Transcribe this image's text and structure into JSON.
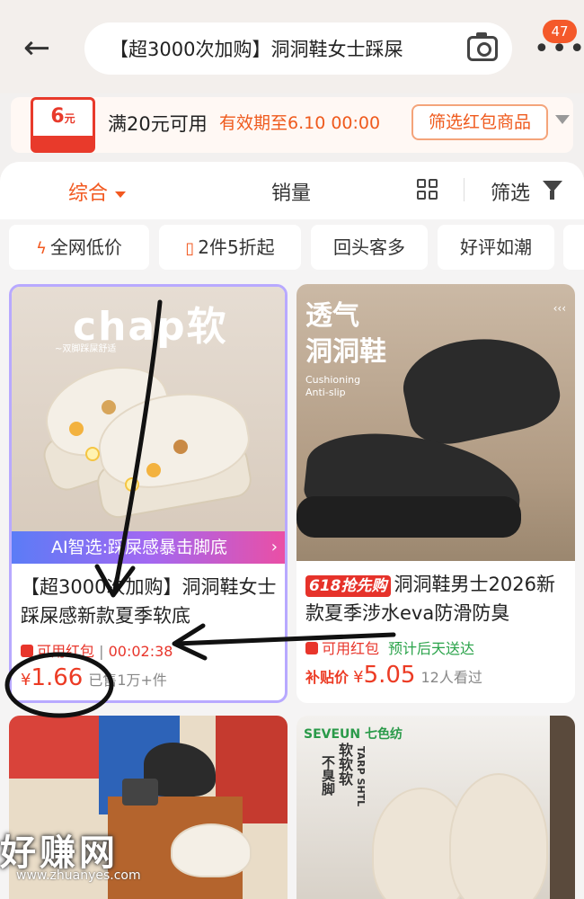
{
  "header": {
    "search_query": "【超3000次加购】洞洞鞋女士踩屎",
    "search_query_fade": "",
    "notification_count": "47"
  },
  "coupon": {
    "amount": "6",
    "currency_unit": "元",
    "condition": "满20元可用",
    "expiry": "有效期至6.10 00:00",
    "button": "筛选红包商品"
  },
  "sort_bar": {
    "comprehensive": "综合",
    "sales": "销量",
    "filter": "筛选"
  },
  "chips": [
    {
      "label": "全网低价",
      "icon": "lightning-icon"
    },
    {
      "label": "2件5折起",
      "icon": "tag-icon"
    },
    {
      "label": "回头客多",
      "icon": ""
    },
    {
      "label": "好评如潮",
      "icon": ""
    }
  ],
  "products": [
    {
      "image_brand": "chap软",
      "image_tagline": "~双脚踩屎舒适",
      "ai_label": "AI智选:踩屎感暴击脚底",
      "title": "【超3000次加购】洞洞鞋女士踩屎感新款夏季软底",
      "coupon_tag": "可用红包",
      "countdown": "00:02:38",
      "currency": "¥",
      "price": "1.66",
      "sold": "已售1万+件"
    },
    {
      "image_headline_1": "透气",
      "image_headline_2": "洞洞鞋",
      "image_sub_1": "Cushioning",
      "image_sub_2": "Anti-slip",
      "promo_tag": "618抢先购",
      "title": "洞洞鞋男士2026新款夏季涉水eva防滑防臭",
      "coupon_tag": "可用红包",
      "delivery": "预计后天送达",
      "price_label": "补贴价",
      "currency": "¥",
      "price": "5.05",
      "viewers": "12人看过"
    },
    {
      "image_logo": "SEVEUN 七色纺",
      "image_vertical_1": "软软软",
      "image_vertical_2": "不臭脚",
      "image_vertical_3": "TARP SHTL"
    }
  ],
  "watermark": {
    "text": "好赚网",
    "url": "www.zhuanyes.com"
  },
  "colors": {
    "accent": "#f2581f",
    "price_red": "#ec3b24",
    "badge": "#f4592a",
    "ai_gradient": [
      "#5b7cf6",
      "#a268f2",
      "#ea4fa5"
    ]
  }
}
